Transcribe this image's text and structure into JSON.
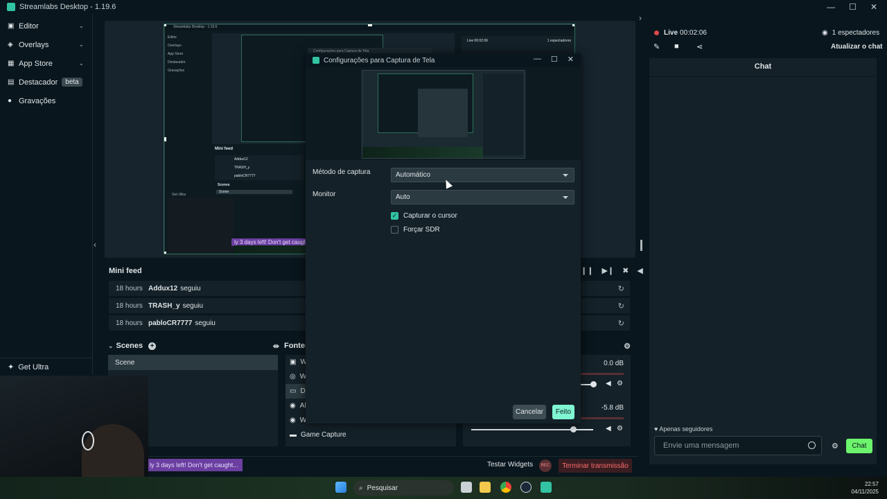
{
  "window": {
    "title": "Streamlabs Desktop - 1.19.6"
  },
  "nav": {
    "items": [
      {
        "label": "Editor"
      },
      {
        "label": "Overlays"
      },
      {
        "label": "App Store"
      },
      {
        "label": "Destacador",
        "badge": "beta"
      },
      {
        "label": "Gravações"
      }
    ],
    "get_ultra": "Get Ultra"
  },
  "minifeed": {
    "title": "Mini feed",
    "rows": [
      {
        "time": "18 hours",
        "user": "Addux12",
        "action": "seguiu"
      },
      {
        "time": "18 hours",
        "user": "TRASH_y",
        "action": "seguiu"
      },
      {
        "time": "18 hours",
        "user": "pabloCR7777",
        "action": "seguiu"
      }
    ]
  },
  "scenes": {
    "title": "Scenes",
    "items": [
      "Scene"
    ]
  },
  "sources": {
    "title": "Fontes",
    "items": [
      "W",
      "W",
      "Di",
      "Al",
      "Webcam",
      "Game Capture"
    ]
  },
  "mixer": {
    "levels": [
      "0.0 dB",
      "-5.8 dB"
    ]
  },
  "bottombar": {
    "banner": "ly 3 days left! Don't get caught...",
    "test_widgets": "Testar Widgets",
    "rec": "REC",
    "end_stream": "Terminar transmissão"
  },
  "rightpanel": {
    "live_label": "Live",
    "live_time": "00:02:06",
    "viewers": "1 espectadores",
    "refresh_chat": "Atualizar o chat",
    "chat_title": "Chat",
    "followers_only": "Apenas seguidores",
    "input_placeholder": "Envie uma mensagem",
    "send_label": "Chat"
  },
  "modal": {
    "title": "Configurações para Captura de Tela",
    "capture_method_label": "Método de captura",
    "capture_method_value": "Automático",
    "monitor_label": "Monitor",
    "monitor_value": "Auto",
    "capture_cursor_label": "Capturar o cursor",
    "capture_cursor_checked": true,
    "force_sdr_label": "Forçar SDR",
    "force_sdr_checked": false,
    "cancel_label": "Cancelar",
    "done_label": "Feito"
  },
  "preview_nested": {
    "title": "Streamlabs Desktop - 1.19.6",
    "nav": [
      "Editor",
      "Overlays",
      "App Store",
      "Destacador",
      "Gravações"
    ],
    "get_ultra": "Get Ultra",
    "minifeed_title": "Mini feed",
    "feed": [
      "Addux12",
      "TRASH_y",
      "pabloCR7777"
    ],
    "scenes": "Scenes",
    "scene": "Scene",
    "chip": "ly 3 days left! Don't get caught...",
    "live": "Live 00:02:06",
    "viewers": "1 espectadores",
    "dialog_title": "Configurações para Captura de Tela"
  },
  "taskbar": {
    "search_placeholder": "Pesquisar",
    "time": "22:57",
    "date": "04/11/2025"
  },
  "colors": {
    "accent": "#31c3a2",
    "background": "#09161d",
    "panel": "#142128",
    "live_red": "#e04848",
    "send_green": "#6cf46c",
    "done_button": "#80f5d2"
  }
}
